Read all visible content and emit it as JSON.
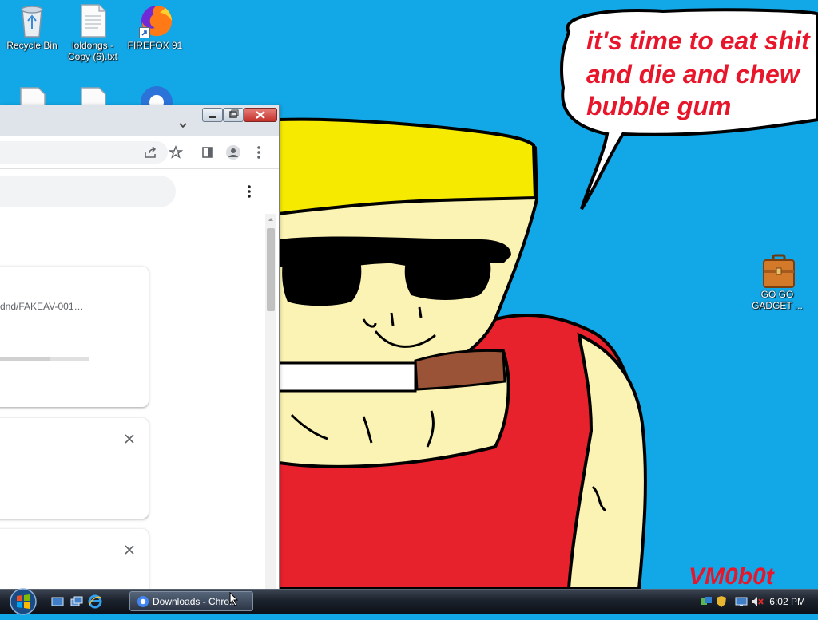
{
  "desktop": {
    "icons": [
      {
        "label": "Recycle Bin",
        "icon": "recycle-bin"
      },
      {
        "label": "loldongs - Copy (6).txt",
        "icon": "text-file"
      },
      {
        "label": "FIREFOX 91",
        "icon": "firefox"
      },
      {
        "label": "GO GO GADGET ...",
        "icon": "briefcase"
      }
    ],
    "wallpaper": {
      "speech_line1": "it's time to eat shit",
      "speech_line2": "and die and chew",
      "speech_line3": "bubble gum",
      "signature": "VM0b0t",
      "colors": {
        "sky": "#12a7e7",
        "text": "#e8162a",
        "shirt": "#e8222c",
        "skin": "#fbf3b3",
        "hat": "#f5ea00"
      }
    }
  },
  "chrome": {
    "download_item_path": "dnd/FAKEAV-001…",
    "toolbar_icons": [
      "share-icon",
      "bookmark-star-icon",
      "side-panel-icon",
      "profile-icon",
      "menu-icon"
    ],
    "progress_fraction": 0.55
  },
  "taskbar": {
    "task_label": "Downloads - Chro...",
    "clock": "6:02 PM"
  }
}
